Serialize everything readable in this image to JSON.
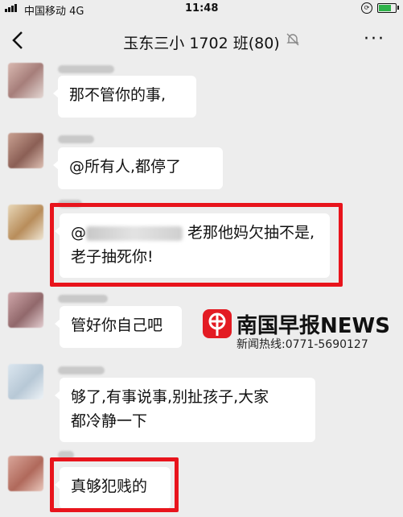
{
  "status_bar": {
    "carrier": "中国移动 4G",
    "time": "11:48",
    "battery_level": 0.85
  },
  "nav": {
    "title": "玉东三小 1702 班(80)",
    "back_icon": "chevron-left-icon",
    "more_icon": "more-dots-icon",
    "mute_icon": "bell-muted-icon",
    "more_label": "···"
  },
  "messages": [
    {
      "text": "那不管你的事,",
      "highlighted": false
    },
    {
      "text": "@所有人,都停了",
      "highlighted": false
    },
    {
      "line1_suffix": "老那他妈欠抽不是,",
      "line2": "老子抽死你!",
      "mention_prefix": "@",
      "highlighted": true
    },
    {
      "text": "管好你自己吧",
      "highlighted": false
    },
    {
      "line1": "够了,有事说事,别扯孩子,大家",
      "line2": "都冷静一下",
      "highlighted": false
    },
    {
      "text": "真够犯贱的",
      "highlighted": true
    }
  ],
  "watermark": {
    "brand": "南国早报NEWS",
    "hotline": "新闻热线:0771-5690127"
  },
  "colors": {
    "background": "#ededed",
    "bubble": "#ffffff",
    "highlight_red": "#e8141c",
    "brand_red": "#e31b23"
  }
}
